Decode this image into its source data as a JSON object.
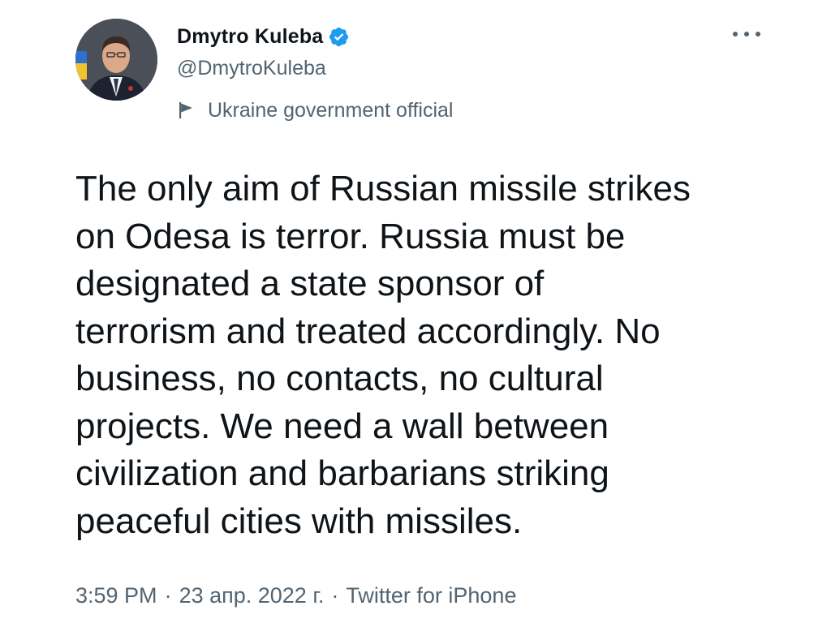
{
  "author": {
    "name": "Dmytro Kuleba",
    "handle": "@DmytroKuleba",
    "label": "Ukraine government official",
    "verified_icon": "verified-badge-icon",
    "label_icon": "flag-icon",
    "verified_color": "#1d9bf0"
  },
  "tweet": {
    "text": "The only aim of Russian missile strikes\non Odesa is terror. Russia must be\ndesignated a state sponsor of\nterrorism and treated accordingly. No\nbusiness, no contacts, no cultural\nprojects. We need a wall between\ncivilization and barbarians striking\npeaceful cities with missiles."
  },
  "meta": {
    "time": "3:59 PM",
    "separator": "·",
    "date": "23 апр. 2022 г.",
    "source": "Twitter for iPhone"
  },
  "colors": {
    "text": "#0f1419",
    "secondary": "#536471",
    "background": "#ffffff"
  }
}
